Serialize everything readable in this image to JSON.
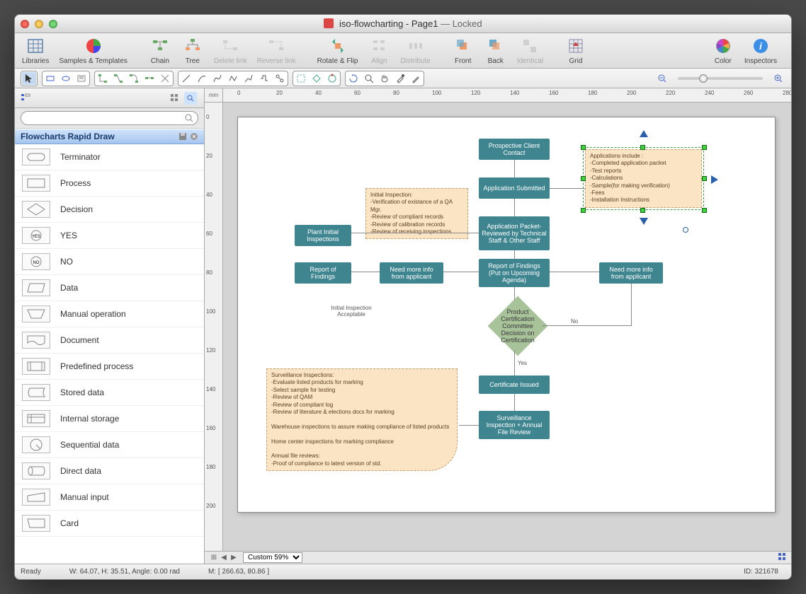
{
  "window": {
    "filename": "iso-flowcharting - Page1",
    "status": "Locked"
  },
  "toolbar": {
    "libraries": "Libraries",
    "samples": "Samples & Templates",
    "chain": "Chain",
    "tree": "Tree",
    "delete_link": "Delete link",
    "reverse_link": "Reverse link",
    "rotate_flip": "Rotate & Flip",
    "align": "Align",
    "distribute": "Distribute",
    "front": "Front",
    "back": "Back",
    "identical": "Identical",
    "grid": "Grid",
    "color": "Color",
    "inspectors": "Inspectors"
  },
  "sidebar": {
    "library_title": "Flowcharts Rapid Draw",
    "search_placeholder": "",
    "shapes": [
      {
        "label": "Terminator"
      },
      {
        "label": "Process"
      },
      {
        "label": "Decision"
      },
      {
        "label": "YES"
      },
      {
        "label": "NO"
      },
      {
        "label": "Data"
      },
      {
        "label": "Manual operation"
      },
      {
        "label": "Document"
      },
      {
        "label": "Predefined process"
      },
      {
        "label": "Stored data"
      },
      {
        "label": "Internal storage"
      },
      {
        "label": "Sequential data"
      },
      {
        "label": "Direct data"
      },
      {
        "label": "Manual input"
      },
      {
        "label": "Card"
      }
    ]
  },
  "ruler_unit": "mm",
  "ruler_ticks_h": [
    "0",
    "20",
    "40",
    "60",
    "80",
    "100",
    "120",
    "140",
    "160",
    "180",
    "200",
    "220",
    "240",
    "260",
    "280"
  ],
  "ruler_ticks_v": [
    "0",
    "20",
    "40",
    "60",
    "80",
    "100",
    "120",
    "140",
    "160",
    "180",
    "200"
  ],
  "flowchart": {
    "n1": "Prospective Client Contact",
    "n2": "Application Submitted",
    "n3": "Application Packet- Reviewed by Technical Staff & Other Staff",
    "n4": "Plant Initial Inspections",
    "n5": "Report of Findings",
    "n6": "Need more info from applicant",
    "n7": "Report of Findings (Put on Upcoming Agenda)",
    "n8": "Need more info from applicant",
    "decision": "Product Certification Committee Decision on Certification",
    "n9": "Certificate Issued",
    "n10": "Surveillance Inspection + Annual File Review",
    "note1_title": "Initial Inspection:",
    "note1_l1": "-Verification of existance of a QA Mgr.",
    "note1_l2": "-Review of compliant records",
    "note1_l3": "-Review of calibration records",
    "note1_l4": "-Review of receiving inspections",
    "note2_title": "Applications include :",
    "note2_l1": "-Completed application packet",
    "note2_l2": "-Test reports",
    "note2_l3": "-Calculations",
    "note2_l4": "-Sample(for making verification)",
    "note2_l5": "-Fees",
    "note2_l6": "-Installation Instructions",
    "note3_title": "Surveillance Inspections:",
    "note3_l1": "-Evaluate listed products for marking",
    "note3_l2": "-Select sample for testing",
    "note3_l3": "-Review of QAM",
    "note3_l4": "-Review of compliant log",
    "note3_l5": "-Review of literature & elections docs for marking",
    "note3_l6": "Warehouse inspections to assure making compliance of listed products",
    "note3_l7": "Home center inspections for marking compliance",
    "note3_l8": "Annual file reviews:",
    "note3_l9": "-Proof of compliance to latest version of std.",
    "lbl_initial": "Initial Inspection Acceptable",
    "lbl_yes": "Yes",
    "lbl_no": "No"
  },
  "zoom": "Custom 59%",
  "statusbar": {
    "ready": "Ready",
    "dims": "W: 64.07,   H: 35.51,   Angle: 0.00 rad",
    "mouse": "M: [ 266.63, 80.86 ]",
    "id": "ID: 321678"
  }
}
